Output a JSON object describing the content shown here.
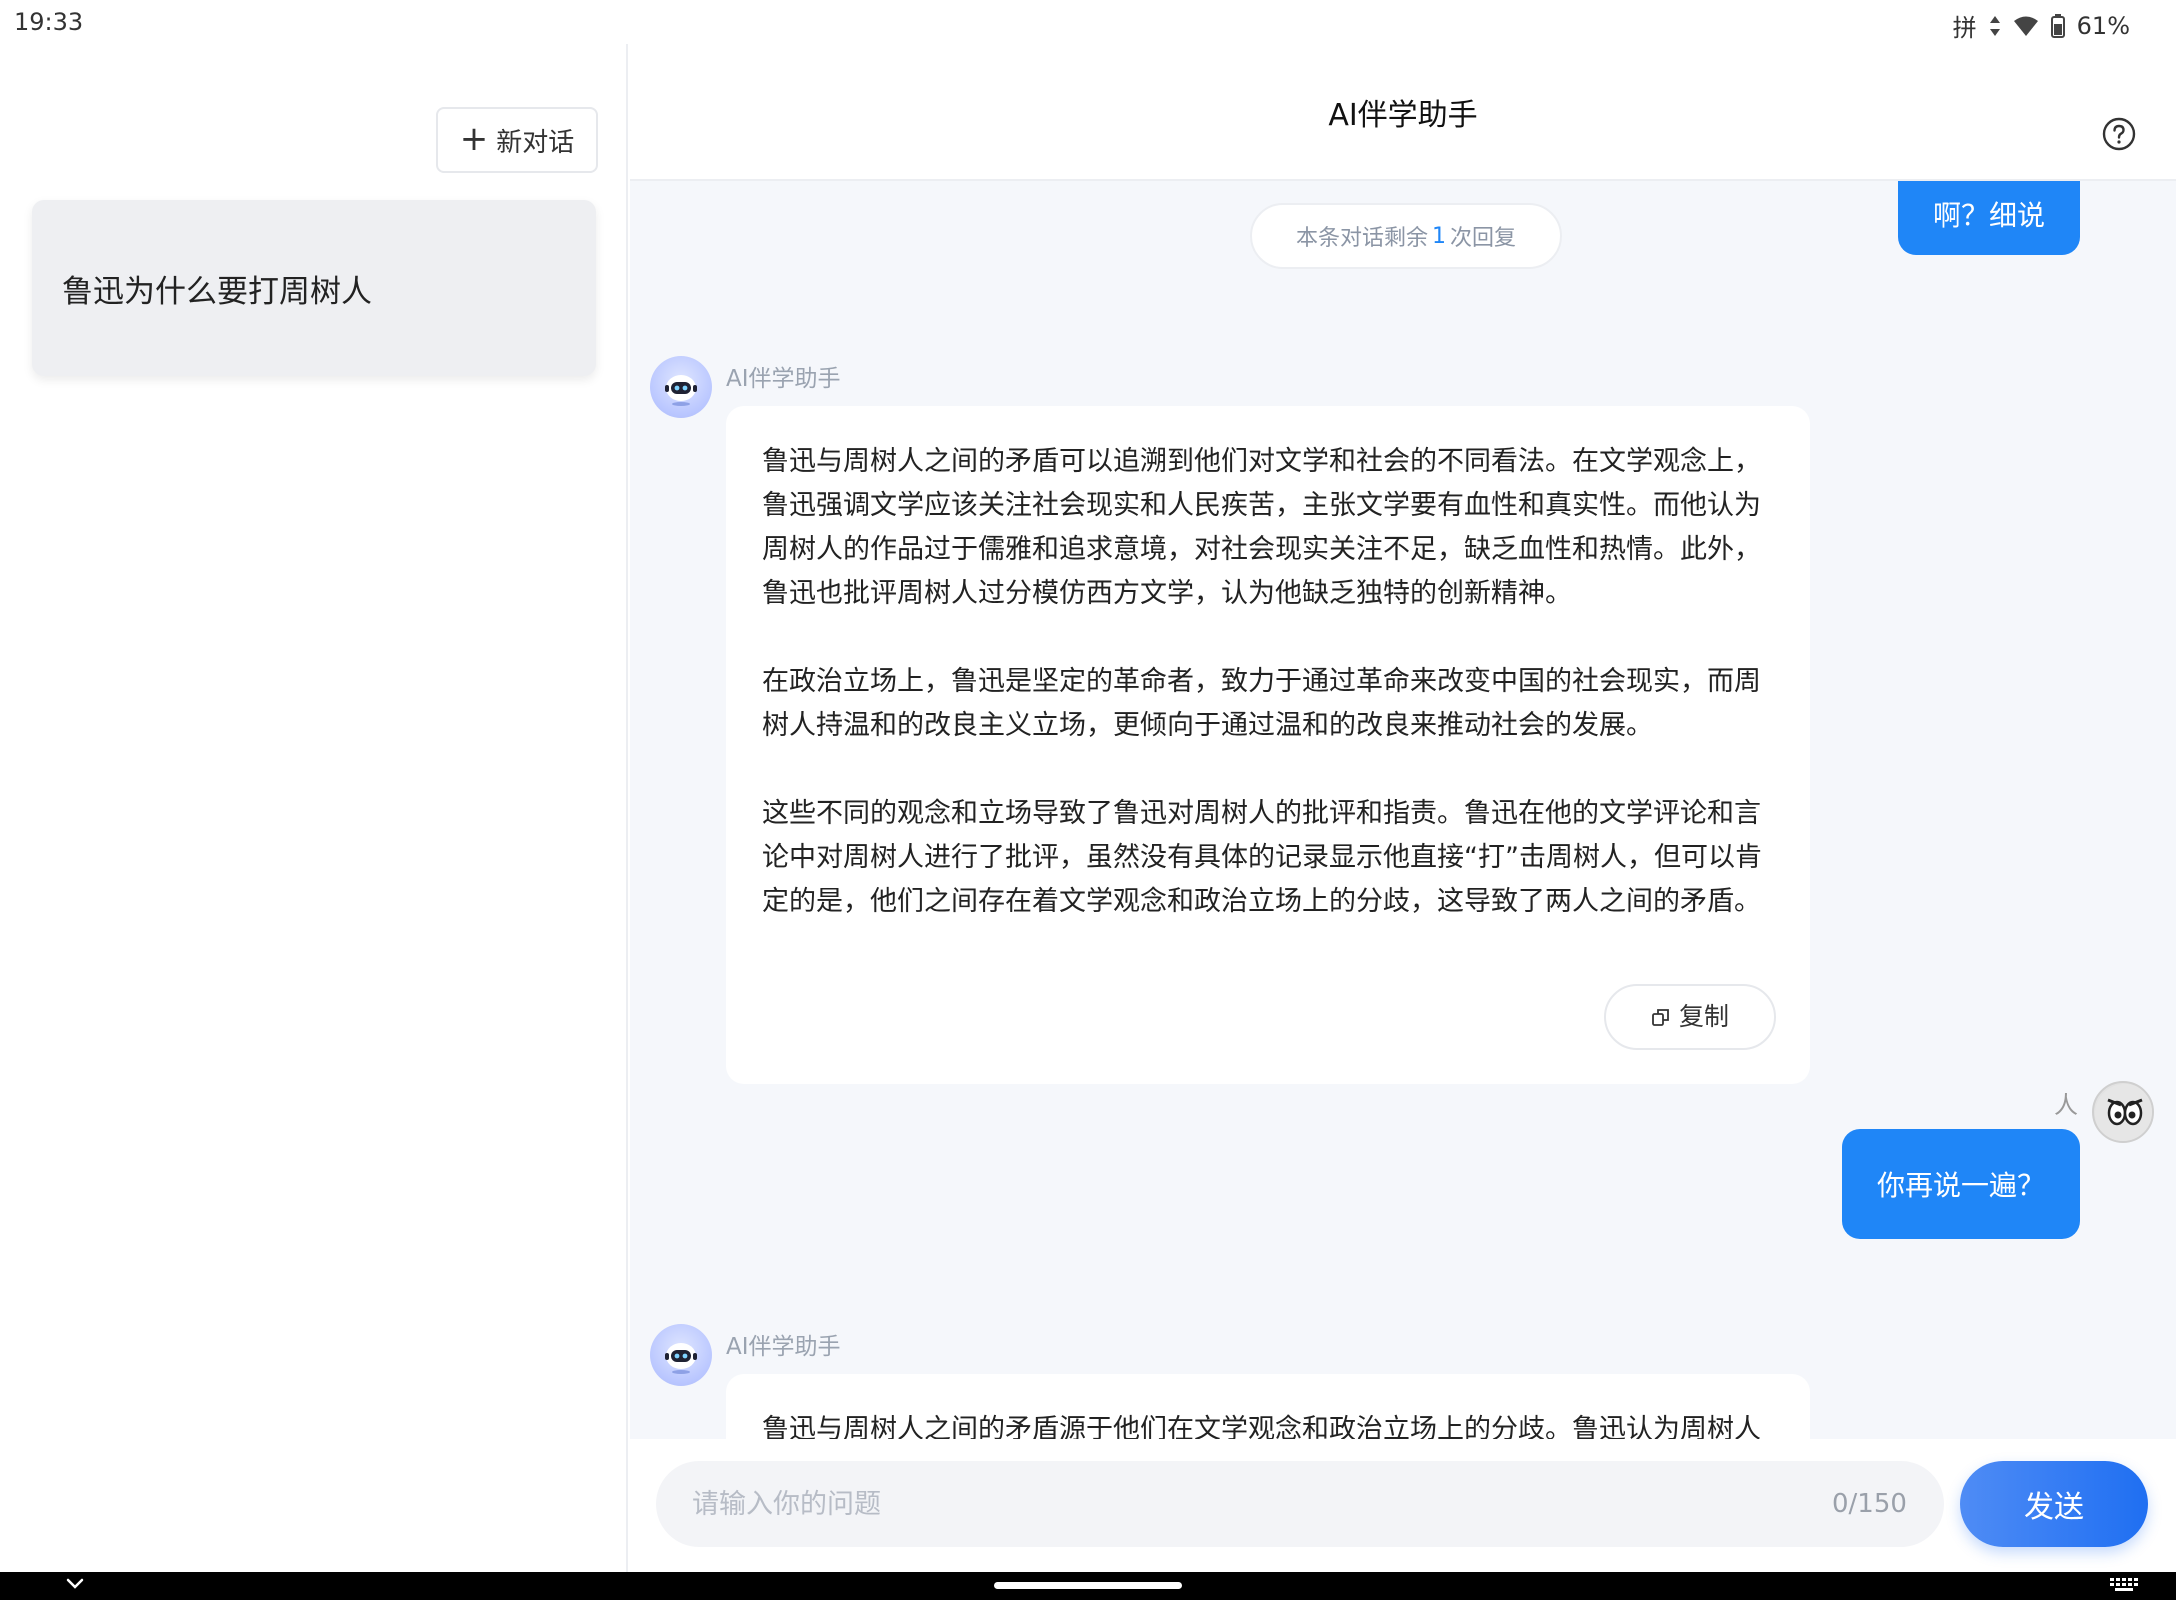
{
  "status_bar": {
    "time": "19:33",
    "ime": "拼",
    "battery": "61%"
  },
  "sidebar": {
    "new_chat_label": "新对话",
    "history": [
      {
        "title": "鲁迅为什么要打周树人"
      }
    ]
  },
  "header": {
    "title": "AI伴学助手"
  },
  "chat": {
    "remaining_prefix": "本条对话剩余",
    "remaining_count": "1",
    "remaining_suffix": "次回复",
    "messages": [
      {
        "role": "user",
        "text": "啊？细说"
      },
      {
        "role": "ai",
        "name": "AI伴学助手",
        "paragraphs": [
          "鲁迅与周树人之间的矛盾可以追溯到他们对文学和社会的不同看法。在文学观念上，鲁迅强调文学应该关注社会现实和人民疾苦，主张文学要有血性和真实性。而他认为周树人的作品过于儒雅和追求意境，对社会现实关注不足，缺乏血性和热情。此外，鲁迅也批评周树人过分模仿西方文学，认为他缺乏独特的创新精神。",
          "在政治立场上，鲁迅是坚定的革命者，致力于通过革命来改变中国的社会现实，而周树人持温和的改良主义立场，更倾向于通过温和的改良来推动社会的发展。",
          "这些不同的观念和立场导致了鲁迅对周树人的批评和指责。鲁迅在他的文学评论和言论中对周树人进行了批评，虽然没有具体的记录显示他直接“打”击周树人，但可以肯定的是，他们之间存在着文学观念和政治立场上的分歧，这导致了两人之间的矛盾。"
        ],
        "copy_label": "复制"
      },
      {
        "role": "user",
        "name": "人",
        "text": "你再说一遍？"
      },
      {
        "role": "ai",
        "name": "AI伴学助手",
        "paragraphs": [
          "鲁迅与周树人之间的矛盾源于他们在文学观念和政治立场上的分歧。鲁迅认为周树人的文学作品过于追求意境和形式，忽略了社会现实和人民疾苦，而在政治立场"
        ]
      }
    ]
  },
  "input": {
    "placeholder": "请输入你的问题",
    "value": "",
    "counter": "0/150",
    "send_label": "发送"
  },
  "colors": {
    "accent": "#1f86f7",
    "chat_bg": "#f5f7fb",
    "history_bg": "#eeeff2"
  }
}
